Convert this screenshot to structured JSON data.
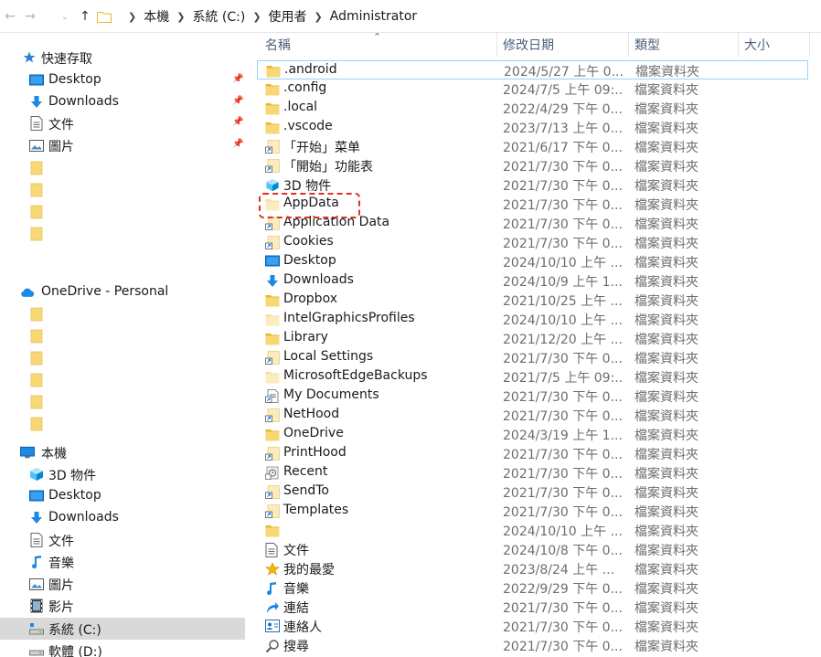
{
  "address": {
    "crumbs": [
      "本機",
      "系統 (C:)",
      "使用者",
      "Administrator"
    ]
  },
  "colors": {
    "folder": "#f8d775",
    "folder_dark": "#e8b830",
    "accent_blue": "#1e88e5",
    "highlight": "#e0301e",
    "selected_bg": "#d9d9d9"
  },
  "sidebar": {
    "quick_access": "快速存取",
    "quick_items": [
      {
        "label": "Desktop",
        "icon": "desktop-icon",
        "pinned": true
      },
      {
        "label": "Downloads",
        "icon": "downloads-icon",
        "pinned": true
      },
      {
        "label": "文件",
        "icon": "documents-icon",
        "pinned": true
      },
      {
        "label": "圖片",
        "icon": "pictures-icon",
        "pinned": true
      }
    ],
    "onedrive": "OneDrive - Personal",
    "this_pc": "本機",
    "pc_items": [
      {
        "label": "3D 物件",
        "icon": "3d-objects-icon"
      },
      {
        "label": "Desktop",
        "icon": "desktop-icon"
      },
      {
        "label": "Downloads",
        "icon": "downloads-icon"
      },
      {
        "label": "文件",
        "icon": "documents-icon"
      },
      {
        "label": "音樂",
        "icon": "music-icon"
      },
      {
        "label": "圖片",
        "icon": "pictures-icon"
      },
      {
        "label": "影片",
        "icon": "videos-icon"
      },
      {
        "label": "系統 (C:)",
        "icon": "system-drive-icon",
        "selected": true
      },
      {
        "label": "軟體 (D:)",
        "icon": "drive-icon"
      }
    ]
  },
  "columns": {
    "name": "名稱",
    "date": "修改日期",
    "type": "類型",
    "size": "大小"
  },
  "files": [
    {
      "name": ".android",
      "date": "2024/5/27 上午 0...",
      "type": "檔案資料夾",
      "icon": "folder"
    },
    {
      "name": ".config",
      "date": "2024/7/5 上午 09:...",
      "type": "檔案資料夾",
      "icon": "folder"
    },
    {
      "name": ".local",
      "date": "2022/4/29 下午 0...",
      "type": "檔案資料夾",
      "icon": "folder"
    },
    {
      "name": ".vscode",
      "date": "2023/7/13 上午 0...",
      "type": "檔案資料夾",
      "icon": "folder"
    },
    {
      "name": "「开始」菜单",
      "date": "2021/6/17 下午 0...",
      "type": "檔案資料夾",
      "icon": "shortcut"
    },
    {
      "name": "「開始」功能表",
      "date": "2021/7/30 下午 0...",
      "type": "檔案資料夾",
      "icon": "shortcut"
    },
    {
      "name": "3D 物件",
      "date": "2021/7/30 下午 0...",
      "type": "檔案資料夾",
      "icon": "3d"
    },
    {
      "name": "AppData",
      "date": "2021/7/30 下午 0...",
      "type": "檔案資料夾",
      "icon": "folder-hidden"
    },
    {
      "name": "Application Data",
      "date": "2021/7/30 下午 0...",
      "type": "檔案資料夾",
      "icon": "shortcut"
    },
    {
      "name": "Cookies",
      "date": "2021/7/30 下午 0...",
      "type": "檔案資料夾",
      "icon": "shortcut"
    },
    {
      "name": "Desktop",
      "date": "2024/10/10 上午 ...",
      "type": "檔案資料夾",
      "icon": "desktop"
    },
    {
      "name": "Downloads",
      "date": "2024/10/9 上午 1...",
      "type": "檔案資料夾",
      "icon": "downloads"
    },
    {
      "name": "Dropbox",
      "date": "2021/10/25 上午 ...",
      "type": "檔案資料夾",
      "icon": "folder"
    },
    {
      "name": "IntelGraphicsProfiles",
      "date": "2024/10/10 上午 ...",
      "type": "檔案資料夾",
      "icon": "folder-hidden"
    },
    {
      "name": "Library",
      "date": "2021/12/20 上午 ...",
      "type": "檔案資料夾",
      "icon": "folder"
    },
    {
      "name": "Local Settings",
      "date": "2021/7/30 下午 0...",
      "type": "檔案資料夾",
      "icon": "shortcut"
    },
    {
      "name": "MicrosoftEdgeBackups",
      "date": "2021/7/5 上午 09:...",
      "type": "檔案資料夾",
      "icon": "folder-hidden"
    },
    {
      "name": "My Documents",
      "date": "2021/7/30 下午 0...",
      "type": "檔案資料夾",
      "icon": "doc-shortcut"
    },
    {
      "name": "NetHood",
      "date": "2021/7/30 下午 0...",
      "type": "檔案資料夾",
      "icon": "shortcut"
    },
    {
      "name": "OneDrive",
      "date": "2024/3/19 上午 1...",
      "type": "檔案資料夾",
      "icon": "folder"
    },
    {
      "name": "PrintHood",
      "date": "2021/7/30 下午 0...",
      "type": "檔案資料夾",
      "icon": "shortcut"
    },
    {
      "name": "Recent",
      "date": "2021/7/30 下午 0...",
      "type": "檔案資料夾",
      "icon": "recent"
    },
    {
      "name": "SendTo",
      "date": "2021/7/30 下午 0...",
      "type": "檔案資料夾",
      "icon": "shortcut"
    },
    {
      "name": "Templates",
      "date": "2021/7/30 下午 0...",
      "type": "檔案資料夾",
      "icon": "shortcut"
    },
    {
      "name": "",
      "date": "2024/10/10 上午 ...",
      "type": "檔案資料夾",
      "icon": "folder"
    },
    {
      "name": "文件",
      "date": "2024/10/8 下午 0...",
      "type": "檔案資料夾",
      "icon": "documents"
    },
    {
      "name": "我的最愛",
      "date": "2023/8/24 上午 ...",
      "type": "檔案資料夾",
      "icon": "favorites"
    },
    {
      "name": "音樂",
      "date": "2022/9/29 下午 0...",
      "type": "檔案資料夾",
      "icon": "music"
    },
    {
      "name": "連結",
      "date": "2021/7/30 下午 0...",
      "type": "檔案資料夾",
      "icon": "links"
    },
    {
      "name": "連絡人",
      "date": "2021/7/30 下午 0...",
      "type": "檔案資料夾",
      "icon": "contacts"
    },
    {
      "name": "搜尋",
      "date": "2021/7/30 下午 0...",
      "type": "檔案資料夾",
      "icon": "search"
    }
  ]
}
